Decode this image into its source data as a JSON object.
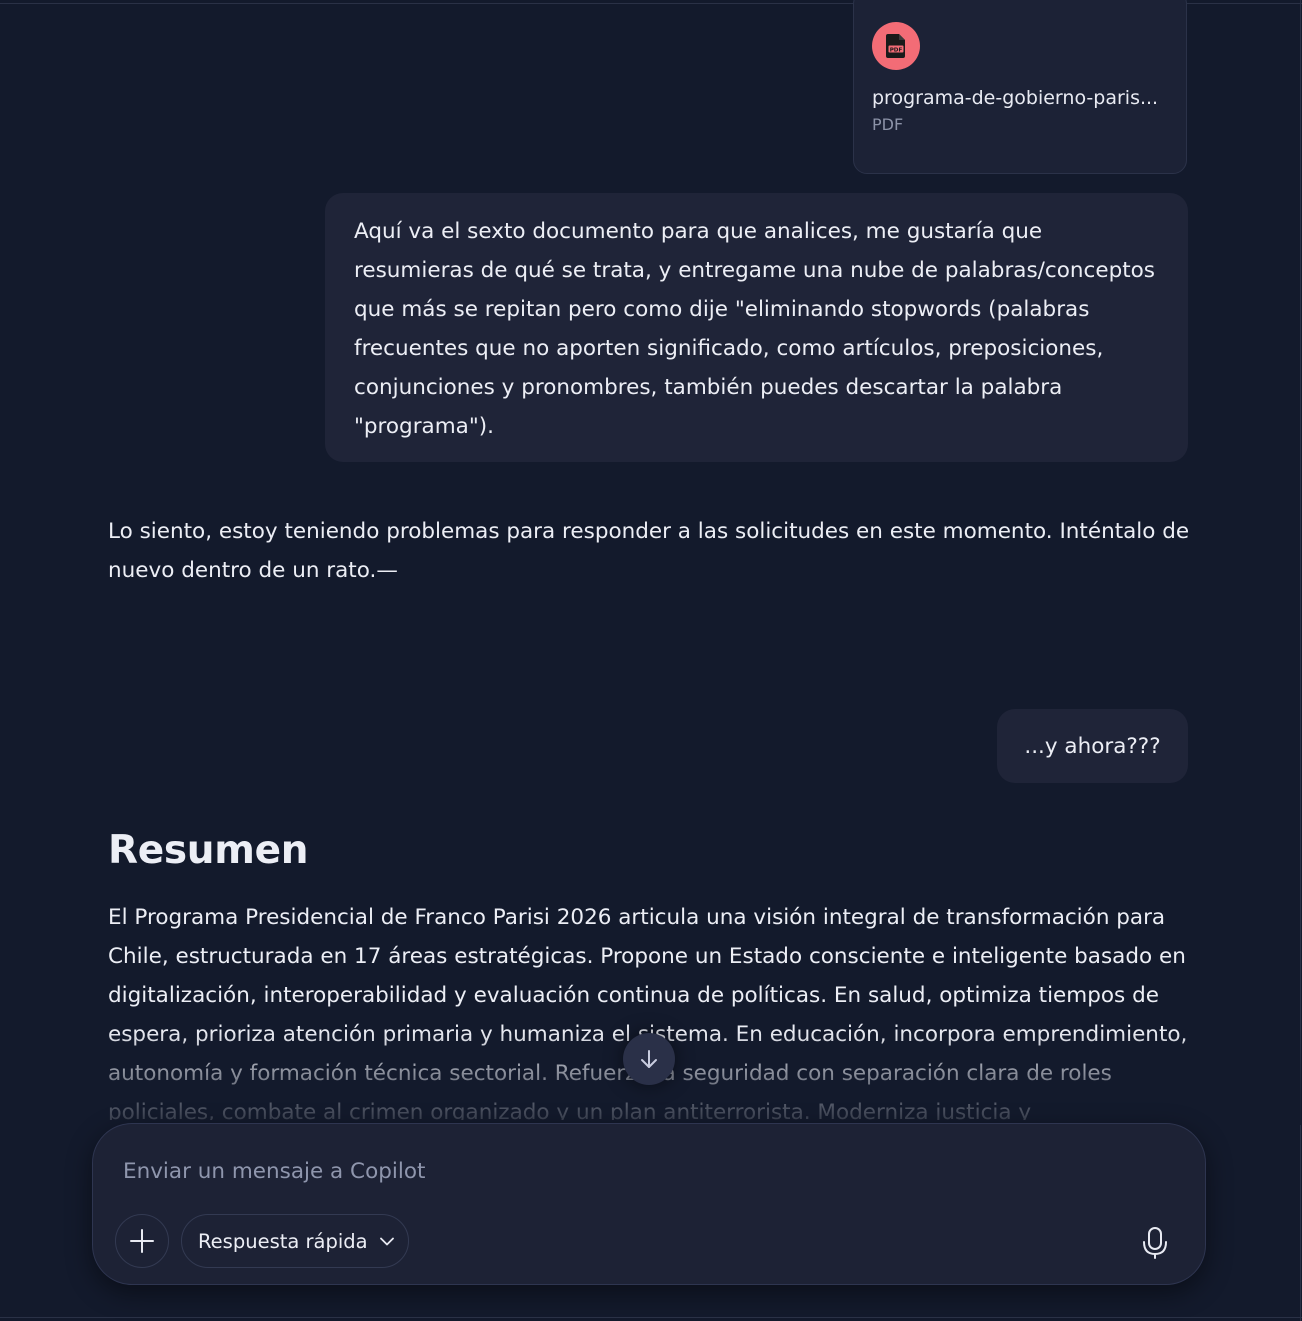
{
  "attachment": {
    "icon": "pdf-file-icon",
    "file_name": "programa-de-gobierno-paris...",
    "file_type": "PDF",
    "icon_color": "#f36c76"
  },
  "messages": {
    "user_1": "Aquí va el sexto documento para que analices, me gustaría que resumieras de qué se trata, y entregame una nube de palabras/conceptos que más se repitan pero como dije \"eliminando stopwords (palabras frecuentes que no aporten significado, como artículos, preposiciones, conjunciones y pronombres, también puedes descartar la palabra \"programa\").",
    "assistant_1": "Lo siento, estoy teniendo problemas para responder a las solicitudes en este momento. Inténtalo de nuevo dentro de un rato.—",
    "user_2": "...y ahora???",
    "assistant_2_heading": "Resumen",
    "assistant_2_body": "El Programa Presidencial de Franco Parisi 2026 articula una visión integral de transformación para Chile, estructurada en 17 áreas estratégicas. Propone un Estado consciente e inteligente basado en digitalización, interoperabilidad y evaluación continua de políticas. En salud, optimiza tiempos de espera, prioriza atención primaria y humaniza el sistema. En educación, incorpora emprendimiento, autonomía y formación técnica sectorial. Refuerza la seguridad con separación clara de roles policiales, combate al crimen organizado y un plan antiterrorista. Moderniza justicia y"
  },
  "scroll_button": {
    "icon": "arrow-down-icon"
  },
  "composer": {
    "placeholder": "Enviar un mensaje a Copilot",
    "value": "",
    "add_icon": "plus-icon",
    "mode_label": "Respuesta rápida",
    "mode_icon": "chevron-down-icon",
    "mic_icon": "microphone-icon"
  },
  "colors": {
    "background": "#131a2c",
    "bubble": "#1f2438",
    "text": "#eceef5",
    "muted": "#8f96ad"
  }
}
